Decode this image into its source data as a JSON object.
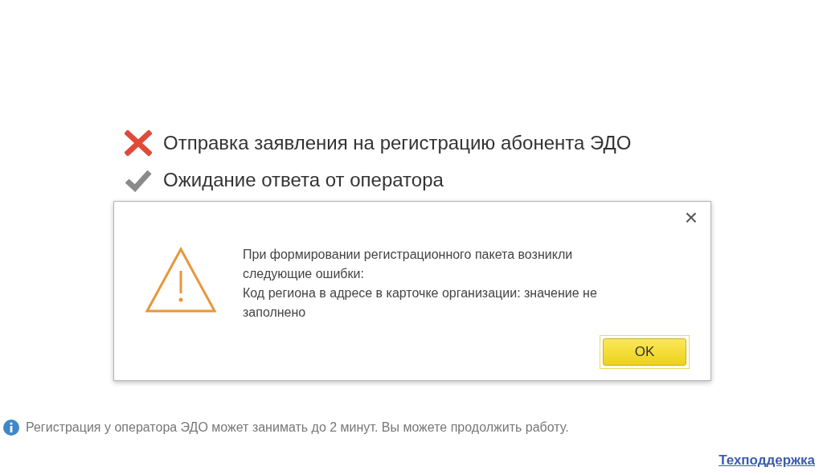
{
  "steps": [
    {
      "kind": "failed",
      "label": "Отправка заявления на регистрацию абонента ЭДО"
    },
    {
      "kind": "waiting",
      "label": "Ожидание ответа от оператора"
    }
  ],
  "dialog": {
    "message_lines": [
      "При формировании регистрационного пакета возникли следующие ошибки:",
      "Код региона в адресе в карточке организации: значение не заполнено"
    ],
    "close": "×",
    "buttons": [
      {
        "label": "OK",
        "focused": true
      }
    ]
  },
  "info": "Регистрация у оператора ЭДО может занимать до 2 минут. Вы можете продолжить работу.",
  "support_link": "Техподдержка"
}
